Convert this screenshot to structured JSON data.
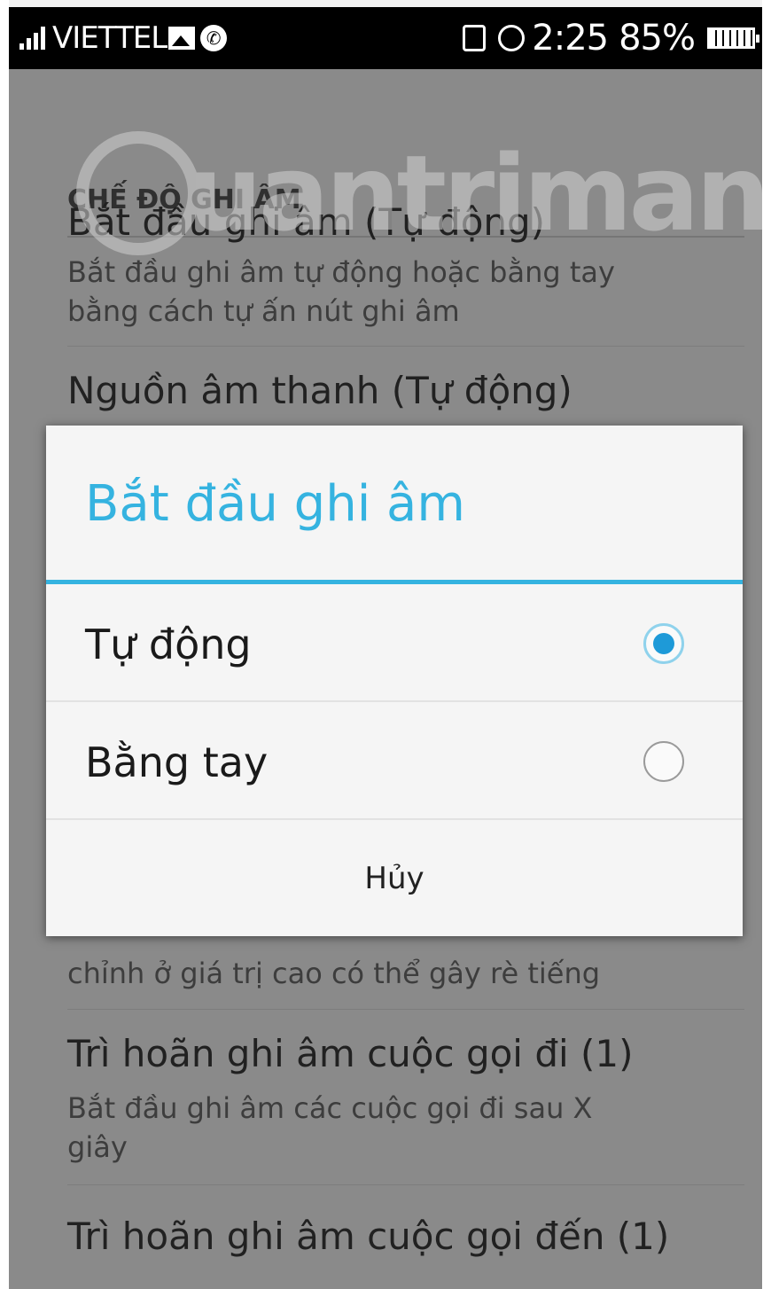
{
  "status_bar": {
    "carrier": "VIETTEL",
    "time": "2:25",
    "battery": "85%",
    "icons": [
      "signal-icon",
      "photo-icon",
      "call-icon",
      "vibrate-icon",
      "alarm-icon",
      "battery-icon"
    ]
  },
  "watermark": {
    "text": "uantrimang"
  },
  "settings": {
    "section_header": "CHẾ ĐỘ GHI ÂM",
    "items": [
      {
        "title": "Bắt đầu ghi âm (Tự động)",
        "summary_lines": [
          "Bắt đầu ghi âm tự động hoặc bằng tay",
          "bằng cách tự ấn nút ghi âm"
        ]
      },
      {
        "title": "Nguồn âm thanh (Tự động)"
      },
      {
        "summary_lines": [
          "chỉnh ở giá trị cao có thể gây rè tiếng"
        ]
      },
      {
        "title": "Trì hoãn ghi âm cuộc gọi đi (1)",
        "summary_lines": [
          "Bắt đầu ghi âm các cuộc gọi đi sau X",
          "giây"
        ]
      },
      {
        "title": "Trì hoãn ghi âm cuộc gọi đến (1)"
      }
    ]
  },
  "dialog": {
    "title": "Bắt đầu ghi âm",
    "options": [
      {
        "label": "Tự động",
        "selected": true
      },
      {
        "label": "Bằng tay",
        "selected": false
      }
    ],
    "cancel_label": "Hủy",
    "accent_color": "#35b3e0"
  }
}
